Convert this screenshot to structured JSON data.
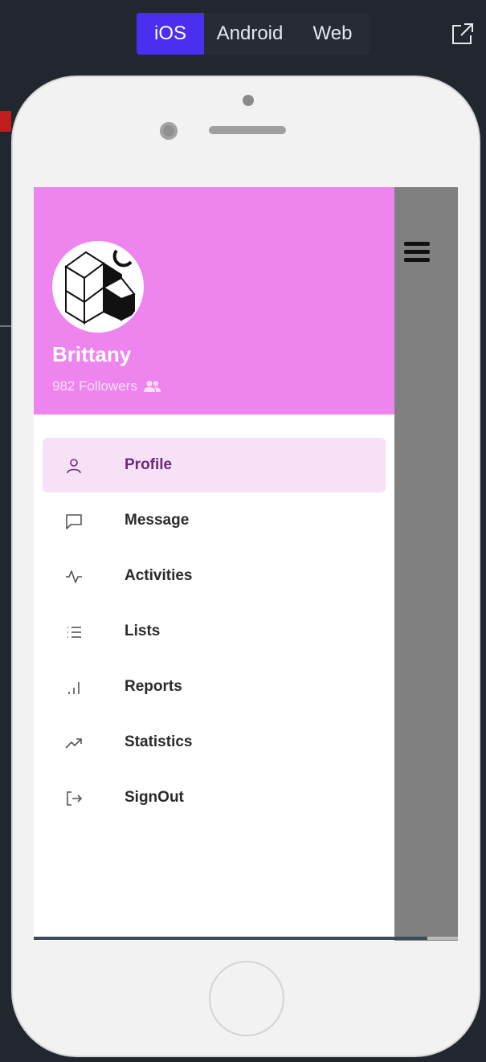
{
  "platform_tabs": [
    {
      "label": "iOS",
      "selected": true
    },
    {
      "label": "Android",
      "selected": false
    },
    {
      "label": "Web",
      "selected": false
    }
  ],
  "colors": {
    "accent": "#4a2ff0",
    "drawer_header": "#ee84ee",
    "active_item_bg": "#f6e1f6",
    "active_item_text": "#6b2a7c",
    "overlay": "#808080"
  },
  "drawer": {
    "user": {
      "name": "Brittany",
      "followers": "982 Followers",
      "avatar_icon": "cube-avatar-icon"
    },
    "menu_items": [
      {
        "label": "Profile",
        "icon": "user-icon",
        "active": true
      },
      {
        "label": "Message",
        "icon": "message-icon",
        "active": false
      },
      {
        "label": "Activities",
        "icon": "activity-icon",
        "active": false
      },
      {
        "label": "Lists",
        "icon": "list-icon",
        "active": false
      },
      {
        "label": "Reports",
        "icon": "bar-chart-icon",
        "active": false
      },
      {
        "label": "Statistics",
        "icon": "trending-up-icon",
        "active": false
      },
      {
        "label": "SignOut",
        "icon": "sign-out-icon",
        "active": false
      }
    ]
  }
}
